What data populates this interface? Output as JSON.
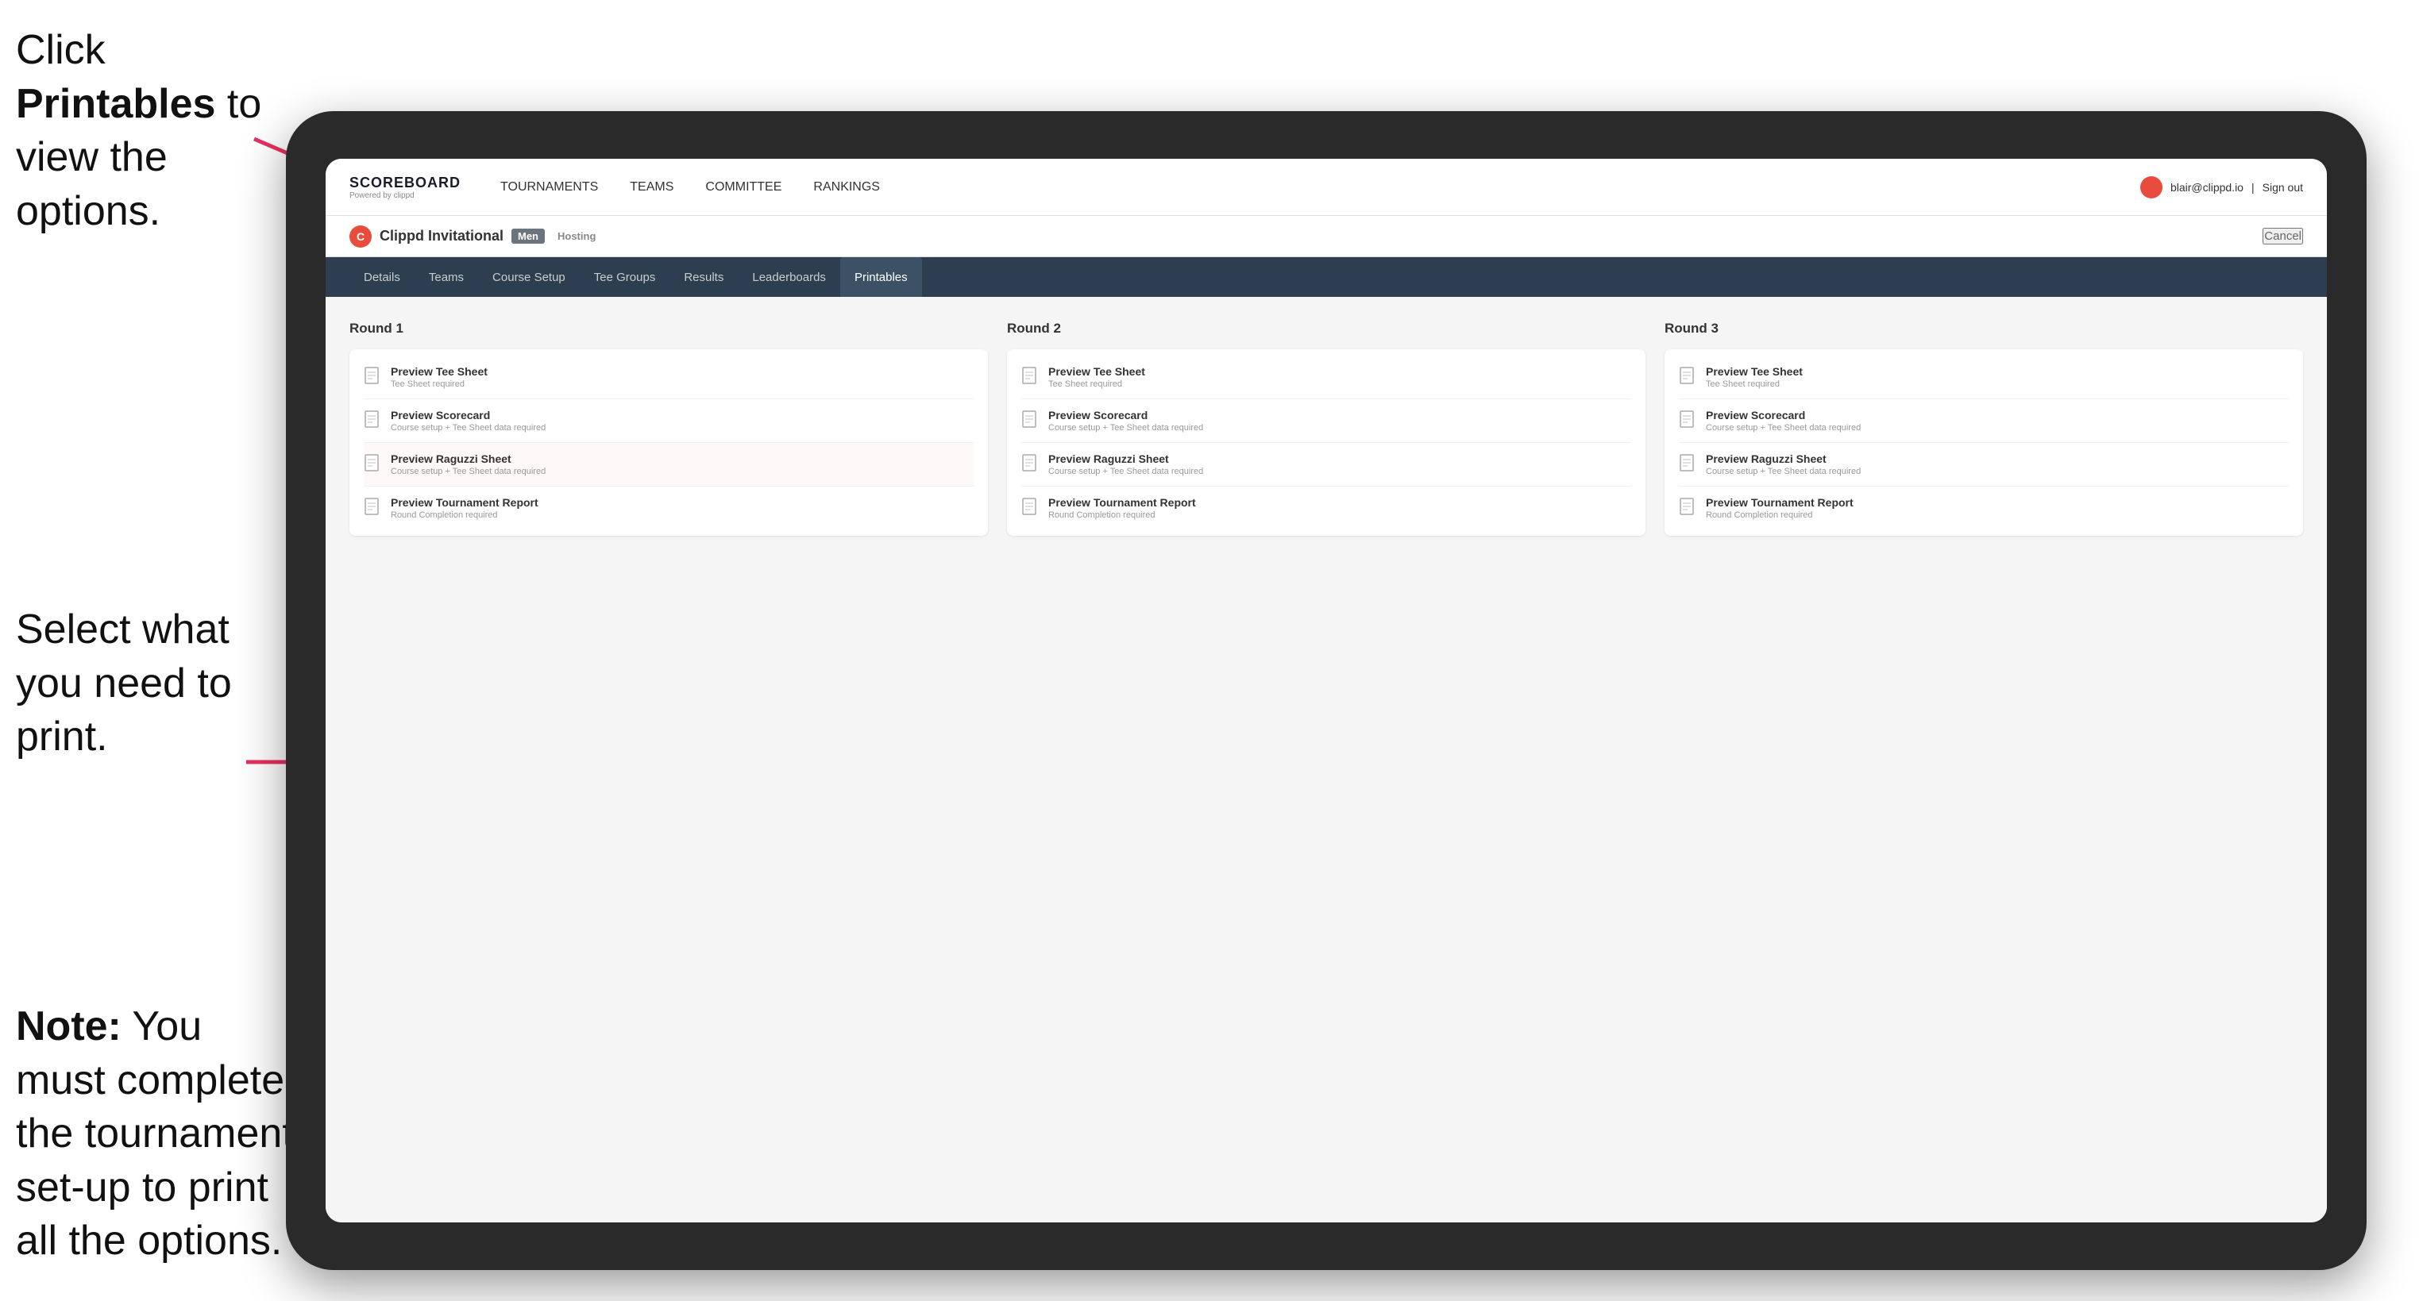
{
  "instructions": {
    "top": {
      "prefix": "Click ",
      "bold": "Printables",
      "suffix": " to view the options."
    },
    "middle": "Select what you need to print.",
    "bottom_prefix": "Note:",
    "bottom_suffix": " You must complete the tournament set-up to print all the options."
  },
  "topNav": {
    "brand": "SCOREBOARD",
    "brandSub": "Powered by clippd",
    "links": [
      "TOURNAMENTS",
      "TEAMS",
      "COMMITTEE",
      "RANKINGS"
    ],
    "userEmail": "blair@clippd.io",
    "signOut": "Sign out"
  },
  "tournament": {
    "name": "Clippd Invitational",
    "badge": "Men",
    "status": "Hosting",
    "cancel": "Cancel"
  },
  "subNav": {
    "tabs": [
      "Details",
      "Teams",
      "Course Setup",
      "Tee Groups",
      "Results",
      "Leaderboards",
      "Printables"
    ],
    "active": "Printables"
  },
  "rounds": [
    {
      "label": "Round 1",
      "items": [
        {
          "title": "Preview Tee Sheet",
          "sub": "Tee Sheet required"
        },
        {
          "title": "Preview Scorecard",
          "sub": "Course setup + Tee Sheet data required"
        },
        {
          "title": "Preview Raguzzi Sheet",
          "sub": "Course setup + Tee Sheet data required"
        },
        {
          "title": "Preview Tournament Report",
          "sub": "Round Completion required"
        }
      ]
    },
    {
      "label": "Round 2",
      "items": [
        {
          "title": "Preview Tee Sheet",
          "sub": "Tee Sheet required"
        },
        {
          "title": "Preview Scorecard",
          "sub": "Course setup + Tee Sheet data required"
        },
        {
          "title": "Preview Raguzzi Sheet",
          "sub": "Course setup + Tee Sheet data required"
        },
        {
          "title": "Preview Tournament Report",
          "sub": "Round Completion required"
        }
      ]
    },
    {
      "label": "Round 3",
      "items": [
        {
          "title": "Preview Tee Sheet",
          "sub": "Tee Sheet required"
        },
        {
          "title": "Preview Scorecard",
          "sub": "Course setup + Tee Sheet data required"
        },
        {
          "title": "Preview Raguzzi Sheet",
          "sub": "Course setup + Tee Sheet data required"
        },
        {
          "title": "Preview Tournament Report",
          "sub": "Round Completion required"
        }
      ]
    }
  ],
  "colors": {
    "accent": "#e74c3c",
    "navBg": "#2c3e50",
    "arrowColor": "#e74c3c"
  }
}
